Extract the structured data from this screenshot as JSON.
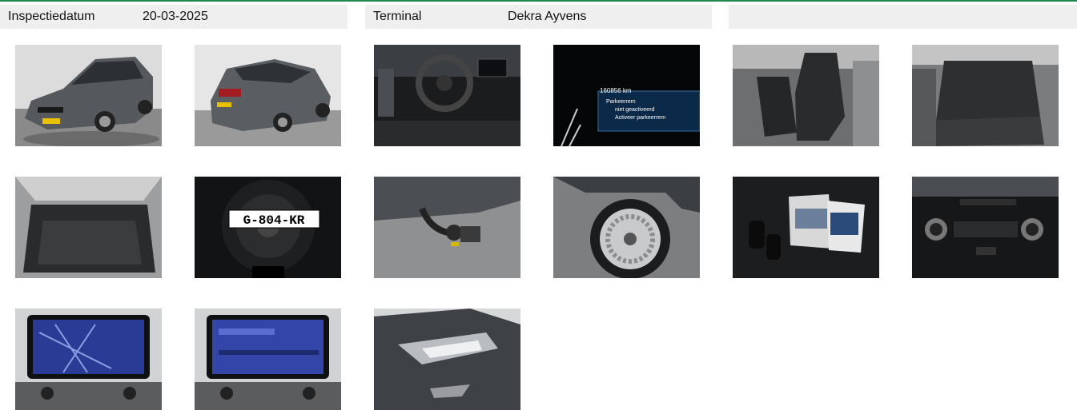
{
  "header": {
    "inspection_label": "Inspectiedatum",
    "inspection_date": "20-03-2025",
    "terminal_label": "Terminal",
    "terminal_value": "Dekra Ayvens"
  },
  "photos": [
    {
      "name": "car-front-photo"
    },
    {
      "name": "car-rear-photo",
      "plate_fragment": "G-804-KR"
    },
    {
      "name": "dashboard-photo"
    },
    {
      "name": "odometer-photo",
      "odometer": "160856 km",
      "msg1": "Parkeerrem",
      "msg2": "niet geactiveerd",
      "msg3": "Activeer parkeerrem"
    },
    {
      "name": "front-seats-photo"
    },
    {
      "name": "rear-seats-photo"
    },
    {
      "name": "trunk-photo"
    },
    {
      "name": "spare-wheel-photo",
      "plate": "G-804-KR"
    },
    {
      "name": "tow-hitch-photo"
    },
    {
      "name": "wheel-photo"
    },
    {
      "name": "keys-manuals-photo"
    },
    {
      "name": "climate-control-photo"
    },
    {
      "name": "navigation-screen-photo"
    },
    {
      "name": "media-screen-photo"
    },
    {
      "name": "headlight-photo"
    }
  ]
}
